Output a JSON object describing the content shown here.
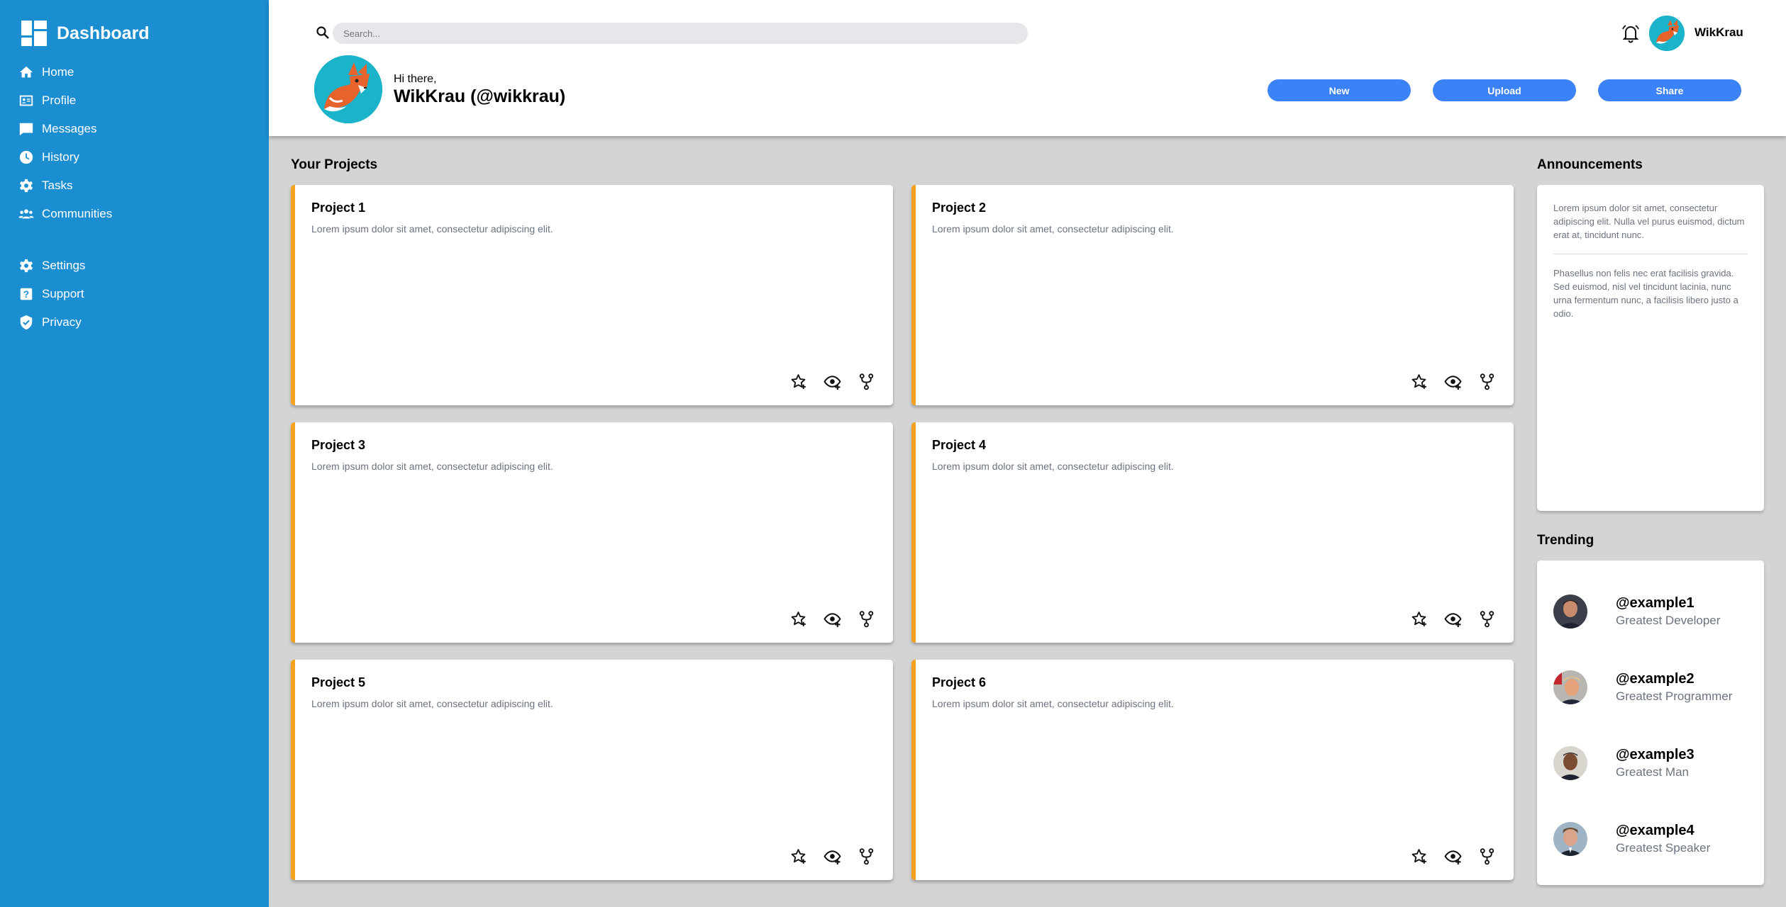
{
  "sidebar": {
    "title": "Dashboard",
    "nav": [
      {
        "label": "Home",
        "icon": "home-icon"
      },
      {
        "label": "Profile",
        "icon": "id-card-icon"
      },
      {
        "label": "Messages",
        "icon": "chat-icon"
      },
      {
        "label": "History",
        "icon": "clock-icon"
      },
      {
        "label": "Tasks",
        "icon": "gear-icon"
      },
      {
        "label": "Communities",
        "icon": "people-icon"
      }
    ],
    "nav2": [
      {
        "label": "Settings",
        "icon": "gear-icon"
      },
      {
        "label": "Support",
        "icon": "question-icon"
      },
      {
        "label": "Privacy",
        "icon": "shield-icon"
      }
    ]
  },
  "header": {
    "search_placeholder": "Search...",
    "username": "WikKrau",
    "greeting": "Hi there,",
    "profile_name": "WikKrau (@wikkrau)",
    "buttons": {
      "new": "New",
      "upload": "Upload",
      "share": "Share"
    }
  },
  "projects": {
    "title": "Your Projects",
    "items": [
      {
        "title": "Project 1",
        "desc": "Lorem ipsum dolor sit amet, consectetur adipiscing elit."
      },
      {
        "title": "Project 2",
        "desc": "Lorem ipsum dolor sit amet, consectetur adipiscing elit."
      },
      {
        "title": "Project 3",
        "desc": "Lorem ipsum dolor sit amet, consectetur adipiscing elit."
      },
      {
        "title": "Project 4",
        "desc": "Lorem ipsum dolor sit amet, consectetur adipiscing elit."
      },
      {
        "title": "Project 5",
        "desc": "Lorem ipsum dolor sit amet, consectetur adipiscing elit."
      },
      {
        "title": "Project 6",
        "desc": "Lorem ipsum dolor sit amet, consectetur adipiscing elit."
      }
    ]
  },
  "announcements": {
    "title": "Announcements",
    "items": [
      "Lorem ipsum dolor sit amet, consectetur adipiscing elit. Nulla vel purus euismod, dictum erat at, tincidunt nunc.",
      "Phasellus non felis nec erat facilisis gravida. Sed euismod, nisl vel tincidunt lacinia, nunc urna fermentum nunc, a facilisis libero justo a odio."
    ]
  },
  "trending": {
    "title": "Trending",
    "items": [
      {
        "handle": "@example1",
        "role": "Greatest Developer"
      },
      {
        "handle": "@example2",
        "role": "Greatest Programmer"
      },
      {
        "handle": "@example3",
        "role": "Greatest Man"
      },
      {
        "handle": "@example4",
        "role": "Greatest Speaker"
      }
    ]
  },
  "colors": {
    "sidebar": "#1b8dd1",
    "button": "#3b82f6",
    "card_accent": "#f4a21f",
    "avatar_bg": "#1ab3c9"
  }
}
